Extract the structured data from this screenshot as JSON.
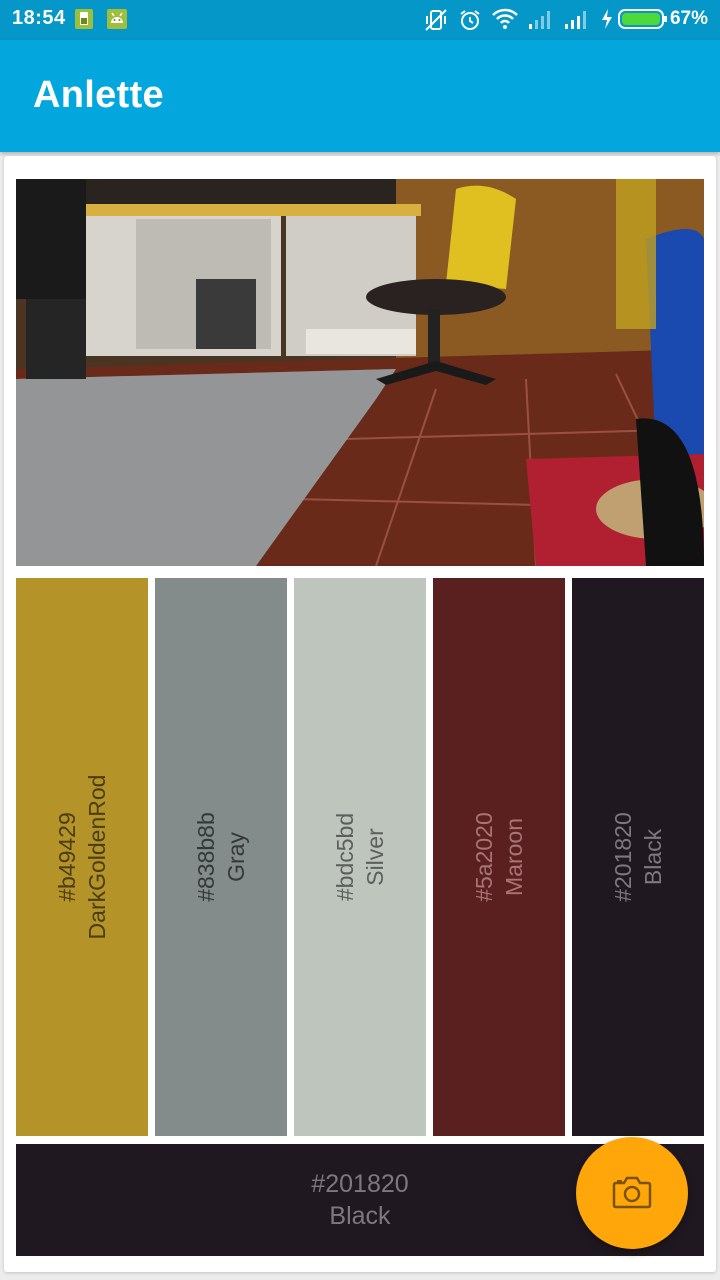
{
  "status_bar": {
    "time": "18:54",
    "battery_percent": "67%",
    "icons": [
      "sim-card-icon",
      "android-icon",
      "vibrate-off-icon",
      "alarm-icon",
      "wifi-icon",
      "signal-weak-icon",
      "signal-icon",
      "charging-icon",
      "battery-icon"
    ]
  },
  "app_bar": {
    "title": "Anlette",
    "color": "#03a7dd"
  },
  "photo": {
    "icon": "office-floor-photo"
  },
  "palette": [
    {
      "hex": "#b49429",
      "name": "DarkGoldenRod",
      "color": "#b49429",
      "text_color": "#4a3d12"
    },
    {
      "hex": "#838b8b",
      "name": "Gray",
      "color": "#838b8b",
      "text_color": "#343838"
    },
    {
      "hex": "#bdc5bd",
      "name": "Silver",
      "color": "#bdc5bd",
      "text_color": "#5c605c"
    },
    {
      "hex": "#5a2020",
      "name": "Maroon",
      "color": "#5a2020",
      "text_color": "#a97474"
    },
    {
      "hex": "#201820",
      "name": "Black",
      "color": "#201820",
      "text_color": "#7f777f"
    }
  ],
  "dominant": {
    "hex": "#201820",
    "name": "Black",
    "color": "#201820",
    "text_color": "#7f777f"
  },
  "fab": {
    "icon": "camera-icon",
    "color": "#ffa70a"
  }
}
